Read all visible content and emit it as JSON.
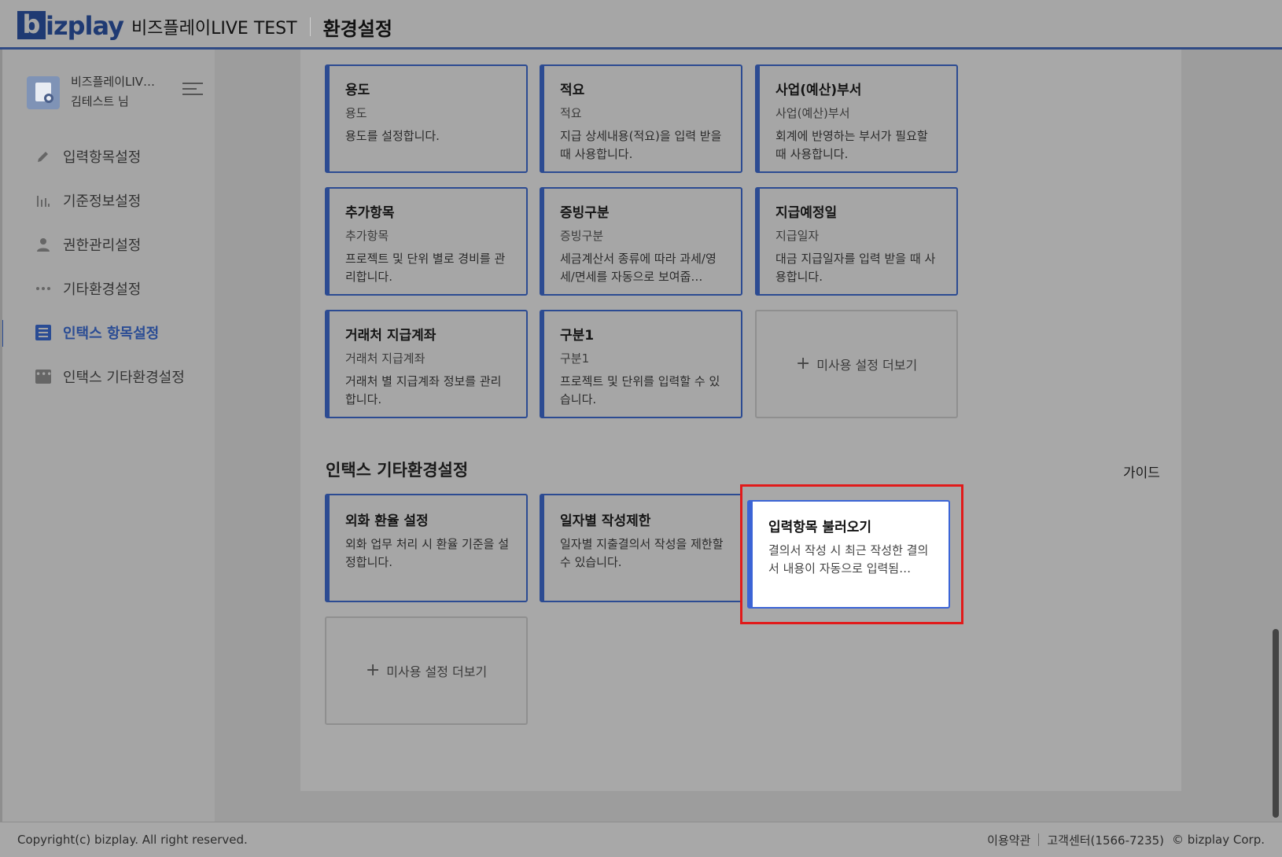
{
  "header": {
    "logo_b": "b",
    "logo_text": "izplay",
    "company": "비즈플레이LIVE TEST",
    "title": "환경설정"
  },
  "user": {
    "company": "비즈플레이LIV…",
    "name": "김테스트 님"
  },
  "nav": {
    "items": [
      {
        "label": "입력항목설정",
        "icon": "pencil-icon"
      },
      {
        "label": "기준정보설정",
        "icon": "bar-chart-icon"
      },
      {
        "label": "권한관리설정",
        "icon": "user-icon"
      },
      {
        "label": "기타환경설정",
        "icon": "more-dots-icon"
      },
      {
        "label": "인택스 항목설정",
        "icon": "list-icon"
      },
      {
        "label": "인택스 기타환경설정",
        "icon": "more-box-icon"
      }
    ],
    "active_index": 4
  },
  "cards_top": [
    {
      "title": "용도",
      "sub": "용도",
      "desc": "용도를 설정합니다."
    },
    {
      "title": "적요",
      "sub": "적요",
      "desc": "지급 상세내용(적요)을 입력 받을 때 사용합니다."
    },
    {
      "title": "사업(예산)부서",
      "sub": "사업(예산)부서",
      "desc": "회계에 반영하는 부서가 필요할 때 사용합니다."
    },
    {
      "title": "추가항목",
      "sub": "추가항목",
      "desc": "프로젝트 및 단위 별로 경비를 관리합니다."
    },
    {
      "title": "증빙구분",
      "sub": "증빙구분",
      "desc": "세금계산서 종류에 따라 과세/영세/면세를 자동으로 보여줍…"
    },
    {
      "title": "지급예정일",
      "sub": "지급일자",
      "desc": "대금 지급일자를 입력 받을 때 사용합니다."
    },
    {
      "title": "거래처 지급계좌",
      "sub": "거래처 지급계좌",
      "desc": "거래처 별 지급계좌 정보를 관리합니다."
    },
    {
      "title": "구분1",
      "sub": "구분1",
      "desc": "프로젝트 및 단위를 입력할 수 있습니다."
    }
  ],
  "more_label": "미사용 설정 더보기",
  "section2": {
    "title": "인택스 기타환경설정",
    "guide": "가이드",
    "cards": [
      {
        "title": "외화 환율 설정",
        "desc": "외화 업무 처리 시 환율 기준을 설정합니다."
      },
      {
        "title": "일자별 작성제한",
        "desc": "일자별 지출결의서 작성을 제한할 수 있습니다."
      },
      {
        "title": "입력항목 불러오기",
        "desc": "결의서 작성 시 최근 작성한 결의서 내용이 자동으로 입력됨…"
      }
    ]
  },
  "footer": {
    "copyright": "Copyright(c) bizplay. All right reserved.",
    "terms": "이용약관",
    "support": "고객센터(1566-7235)",
    "corp": "© bizplay Corp."
  },
  "colors": {
    "accent": "#2c4b92",
    "highlight": "#e11a1a",
    "bright_card_border": "#3b64d6"
  }
}
